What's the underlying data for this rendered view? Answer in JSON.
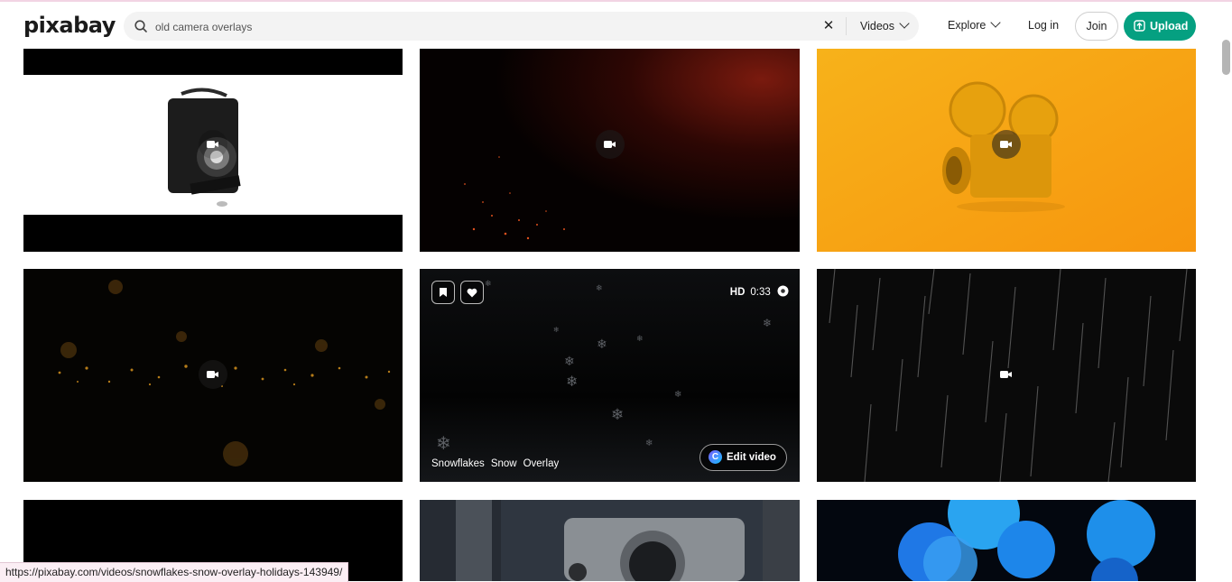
{
  "brand": {
    "logo_text": "pixabay"
  },
  "search": {
    "value": "old camera overlays",
    "clear_glyph": "✕",
    "type_label": "Videos"
  },
  "nav": {
    "explore_label": "Explore",
    "login_label": "Log in",
    "join_label": "Join",
    "upload_label": "Upload"
  },
  "results": [
    {
      "kind": "vintage-camera-white"
    },
    {
      "kind": "embers-dark-red"
    },
    {
      "kind": "movie-camera-orange"
    },
    {
      "kind": "gold-particles"
    },
    {
      "kind": "snowflakes-hovered",
      "quality": "HD",
      "duration": "0:33",
      "tags": [
        "Snowflakes",
        "Snow",
        "Overlay"
      ],
      "edit_label": "Edit video"
    },
    {
      "kind": "rain-streaks"
    },
    {
      "kind": "dark"
    },
    {
      "kind": "metal-camera-parts"
    },
    {
      "kind": "blue-bokeh"
    }
  ],
  "status_bar": {
    "url": "https://pixabay.com/videos/snowflakes-snow-overlay-holidays-143949/"
  },
  "colors": {
    "upload_green": "#05a081",
    "status_bg": "#fbeef4"
  },
  "icons": [
    "search-icon",
    "close-icon",
    "chevron-down-icon",
    "upload-icon",
    "video-camera-icon",
    "bookmark-icon",
    "heart-icon",
    "info-icon",
    "canva-icon"
  ]
}
